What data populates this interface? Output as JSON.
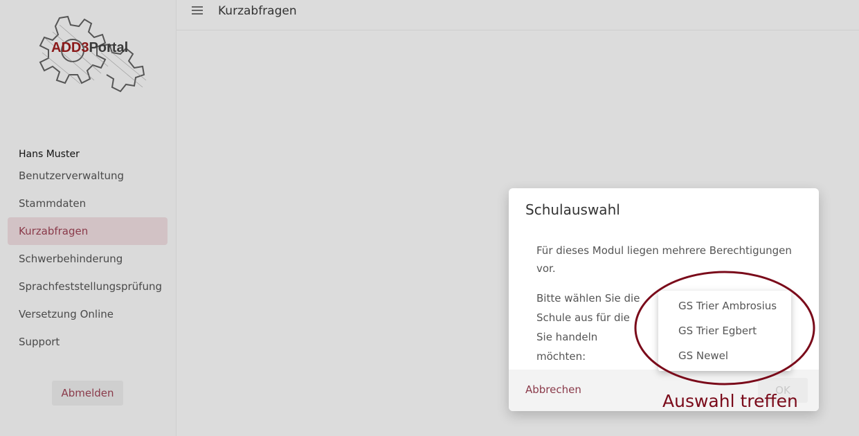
{
  "sidebar": {
    "logo": {
      "text_add3": "ADD3",
      "text_portal": "Portal"
    },
    "user_name": "Hans Muster",
    "items": [
      {
        "label": "Benutzerverwaltung"
      },
      {
        "label": "Stammdaten"
      },
      {
        "label": "Kurzabfragen",
        "active": true
      },
      {
        "label": "Schwerbehinderung"
      },
      {
        "label": "Sprachfeststellungsprüfung"
      },
      {
        "label": "Versetzung Online"
      },
      {
        "label": "Support"
      }
    ],
    "logout_label": "Abmelden"
  },
  "header": {
    "title": "Kurzabfragen",
    "menu_icon": "hamburger-menu-icon"
  },
  "dialog": {
    "title": "Schulauswahl",
    "message": "Für dieses Modul liegen mehrere Berechtigungen vor.",
    "prompt": "Bitte wählen Sie die Schule aus für die Sie handeln möchten:",
    "cancel_label": "Abbrechen",
    "ok_label": "OK"
  },
  "dropdown": {
    "options": [
      "GS Trier Ambrosius",
      "GS Trier Egbert",
      "GS Newel"
    ]
  },
  "annotation": {
    "text": "Auswahl treffen",
    "color": "#7a0a1a"
  },
  "colors": {
    "accent": "#8a3a4a",
    "active_bg": "#d2c2c5",
    "background": "#dcdcdc"
  }
}
